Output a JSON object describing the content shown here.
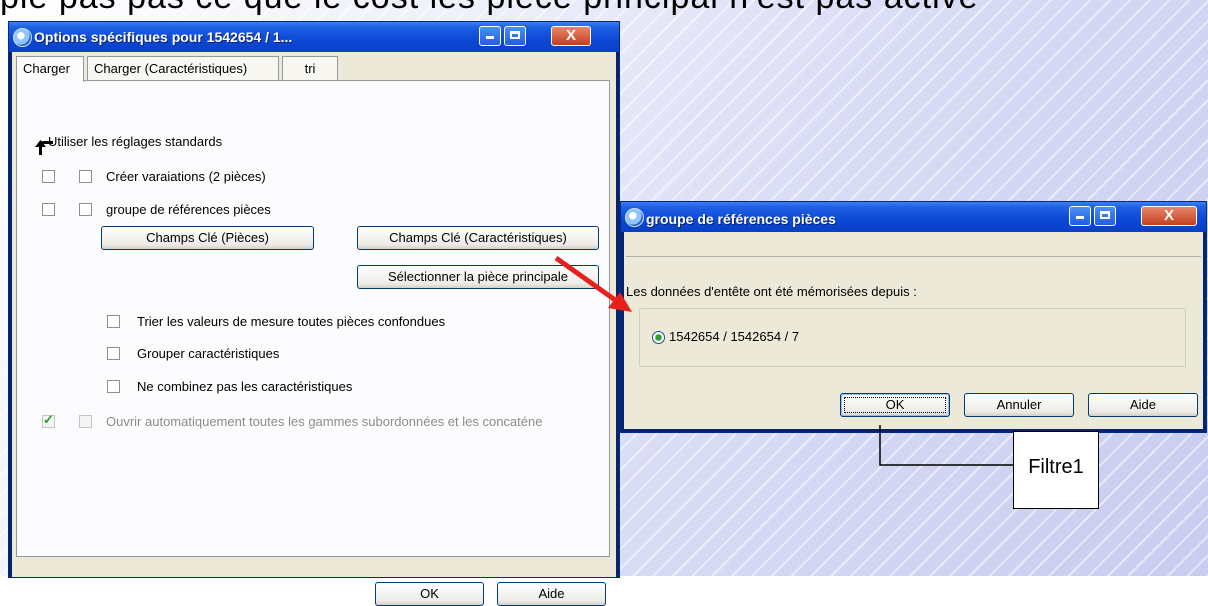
{
  "background": {
    "top_text": "pie pas pas ce que le cost les pièce principal n'est pas active"
  },
  "dialog1": {
    "title": "Options spécifiques pour 1542654 / 1...",
    "tabs": [
      "Charger",
      "Charger (Caractéristiques)",
      "tri"
    ],
    "use_standard_settings_label": "Utiliser les réglages standards",
    "rows": [
      {
        "label": "Créer varaiations (2 pièces)"
      },
      {
        "label": "groupe de références pièces"
      }
    ],
    "buttons": {
      "key_fields_parts": "Champs Clé (Pièces)",
      "key_fields_characteristics": "Champs Clé (Caractéristiques)",
      "select_main_part": "Sélectionner la pièce principale",
      "ok": "OK",
      "help": "Aide"
    },
    "options": [
      {
        "label": "Trier les valeurs de mesure toutes pièces confondues",
        "checked": false
      },
      {
        "label": "Grouper caractéristiques",
        "checked": false
      },
      {
        "label": "Ne combinez pas les caractéristiques",
        "checked": false
      }
    ],
    "auto_open": {
      "label": "Ouvrir automatiquement toutes les gammes subordonnées et les concaténe",
      "checked": true
    }
  },
  "dialog2": {
    "title": "groupe de références pièces",
    "message": "Les données d'entête ont été mémorisées depuis :",
    "radio_option": "1542654 / 1542654 / 7",
    "buttons": {
      "ok": "OK",
      "cancel": "Annuler",
      "help": "Aide"
    }
  },
  "annotation": {
    "filter_label": "Filtre1",
    "arrow_color": "#e8201c"
  }
}
